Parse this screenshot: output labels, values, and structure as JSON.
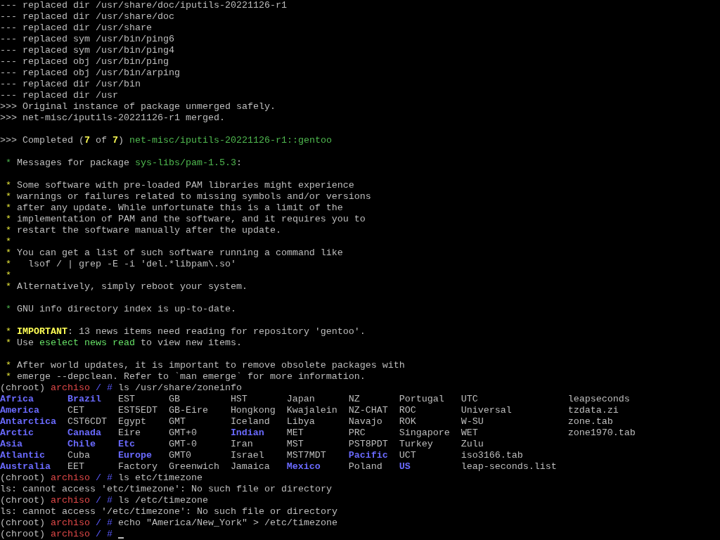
{
  "lines": [
    {
      "kind": "text",
      "segments": [
        {
          "kind": "plain",
          "text": "--- replaced dir /usr/share/doc/iputils-20221126-r1"
        }
      ]
    },
    {
      "kind": "text",
      "segments": [
        {
          "kind": "plain",
          "text": "--- replaced dir /usr/share/doc"
        }
      ]
    },
    {
      "kind": "text",
      "segments": [
        {
          "kind": "plain",
          "text": "--- replaced dir /usr/share"
        }
      ]
    },
    {
      "kind": "text",
      "segments": [
        {
          "kind": "plain",
          "text": "--- replaced sym /usr/bin/ping6"
        }
      ]
    },
    {
      "kind": "text",
      "segments": [
        {
          "kind": "plain",
          "text": "--- replaced sym /usr/bin/ping4"
        }
      ]
    },
    {
      "kind": "text",
      "segments": [
        {
          "kind": "plain",
          "text": "--- replaced obj /usr/bin/ping"
        }
      ]
    },
    {
      "kind": "text",
      "segments": [
        {
          "kind": "plain",
          "text": "--- replaced obj /usr/bin/arping"
        }
      ]
    },
    {
      "kind": "text",
      "segments": [
        {
          "kind": "plain",
          "text": "--- replaced dir /usr/bin"
        }
      ]
    },
    {
      "kind": "text",
      "segments": [
        {
          "kind": "plain",
          "text": "--- replaced dir /usr"
        }
      ]
    },
    {
      "kind": "text",
      "segments": [
        {
          "kind": "plain",
          "text": ">>> Original instance of package unmerged safely."
        }
      ]
    },
    {
      "kind": "text",
      "segments": [
        {
          "kind": "plain",
          "text": ">>> net-misc/iputils-20221126-r1 merged."
        }
      ]
    },
    {
      "kind": "blank"
    },
    {
      "kind": "text",
      "segments": [
        {
          "kind": "plain",
          "text": ">>> Completed ("
        },
        {
          "kind": "number",
          "text": "7"
        },
        {
          "kind": "plain",
          "text": " of "
        },
        {
          "kind": "number",
          "text": "7"
        },
        {
          "kind": "plain",
          "text": ") "
        },
        {
          "kind": "package",
          "text": "net-misc/iputils-20221126-r1::gentoo"
        }
      ]
    },
    {
      "kind": "blank"
    },
    {
      "kind": "text",
      "segments": [
        {
          "kind": "ok-star",
          "text": "*"
        },
        {
          "kind": "plain",
          "text": "Messages for package "
        },
        {
          "kind": "package",
          "text": "sys-libs/pam-1.5.3"
        },
        {
          "kind": "plain",
          "text": ":"
        }
      ]
    },
    {
      "kind": "blank"
    },
    {
      "kind": "text",
      "segments": [
        {
          "kind": "warn-star",
          "text": "*"
        },
        {
          "kind": "plain",
          "text": "Some software with pre-loaded PAM libraries might experience"
        }
      ]
    },
    {
      "kind": "text",
      "segments": [
        {
          "kind": "warn-star",
          "text": "*"
        },
        {
          "kind": "plain",
          "text": "warnings or failures related to missing symbols and/or versions"
        }
      ]
    },
    {
      "kind": "text",
      "segments": [
        {
          "kind": "warn-star",
          "text": "*"
        },
        {
          "kind": "plain",
          "text": "after any update. While unfortunate this is a limit of the"
        }
      ]
    },
    {
      "kind": "text",
      "segments": [
        {
          "kind": "warn-star",
          "text": "*"
        },
        {
          "kind": "plain",
          "text": "implementation of PAM and the software, and it requires you to"
        }
      ]
    },
    {
      "kind": "text",
      "segments": [
        {
          "kind": "warn-star",
          "text": "*"
        },
        {
          "kind": "plain",
          "text": "restart the software manually after the update."
        }
      ]
    },
    {
      "kind": "text",
      "segments": [
        {
          "kind": "warn-star",
          "text": "*"
        }
      ]
    },
    {
      "kind": "text",
      "segments": [
        {
          "kind": "warn-star",
          "text": "*"
        },
        {
          "kind": "plain",
          "text": "You can get a list of such software running a command like"
        }
      ]
    },
    {
      "kind": "text",
      "segments": [
        {
          "kind": "warn-star",
          "text": "*"
        },
        {
          "kind": "plain",
          "text": "  lsof / | grep -E -i 'del.*libpam\\.so'"
        }
      ]
    },
    {
      "kind": "text",
      "segments": [
        {
          "kind": "warn-star",
          "text": "*"
        }
      ]
    },
    {
      "kind": "text",
      "segments": [
        {
          "kind": "warn-star",
          "text": "*"
        },
        {
          "kind": "plain",
          "text": "Alternatively, simply reboot your system."
        }
      ]
    },
    {
      "kind": "blank"
    },
    {
      "kind": "text",
      "segments": [
        {
          "kind": "ok-star",
          "text": "*"
        },
        {
          "kind": "plain",
          "text": "GNU info directory index is up-to-date."
        }
      ]
    },
    {
      "kind": "blank"
    },
    {
      "kind": "text",
      "segments": [
        {
          "kind": "warn-star",
          "text": "*"
        },
        {
          "kind": "important",
          "text": "IMPORTANT"
        },
        {
          "kind": "plain",
          "text": ": 13 news items need reading for repository 'gentoo'."
        }
      ]
    },
    {
      "kind": "text",
      "segments": [
        {
          "kind": "warn-star",
          "text": "*"
        },
        {
          "kind": "plain",
          "text": "Use "
        },
        {
          "kind": "command",
          "text": "eselect news read"
        },
        {
          "kind": "plain",
          "text": " to view new items."
        }
      ]
    },
    {
      "kind": "blank"
    },
    {
      "kind": "text",
      "segments": [
        {
          "kind": "warn-star",
          "text": "*"
        },
        {
          "kind": "plain",
          "text": "After world updates, it is important to remove obsolete packages with"
        }
      ]
    },
    {
      "kind": "text",
      "segments": [
        {
          "kind": "warn-star",
          "text": "*"
        },
        {
          "kind": "plain",
          "text": "emerge --depclean. Refer to `man emerge` for more information."
        }
      ]
    },
    {
      "kind": "prompt",
      "chroot": "(chroot)",
      "host": "archiso",
      "dir": "/",
      "sigil": "#",
      "command": "ls /usr/share/zoneinfo",
      "cursor": false
    },
    {
      "kind": "listing",
      "entries": [
        {
          "name": "Africa",
          "kind": "dir"
        },
        {
          "name": "America",
          "kind": "dir"
        },
        {
          "name": "Antarctica",
          "kind": "dir"
        },
        {
          "name": "Arctic",
          "kind": "dir"
        },
        {
          "name": "Asia",
          "kind": "dir"
        },
        {
          "name": "Atlantic",
          "kind": "dir"
        },
        {
          "name": "Australia",
          "kind": "dir"
        },
        {
          "name": "Brazil",
          "kind": "dir"
        },
        {
          "name": "CET",
          "kind": "file"
        },
        {
          "name": "CST6CDT",
          "kind": "file"
        },
        {
          "name": "Canada",
          "kind": "dir"
        },
        {
          "name": "Chile",
          "kind": "dir"
        },
        {
          "name": "Cuba",
          "kind": "file"
        },
        {
          "name": "EET",
          "kind": "file"
        },
        {
          "name": "EST",
          "kind": "file"
        },
        {
          "name": "EST5EDT",
          "kind": "file"
        },
        {
          "name": "Egypt",
          "kind": "file"
        },
        {
          "name": "Eire",
          "kind": "file"
        },
        {
          "name": "Etc",
          "kind": "dir"
        },
        {
          "name": "Europe",
          "kind": "dir"
        },
        {
          "name": "Factory",
          "kind": "file"
        },
        {
          "name": "GB",
          "kind": "file"
        },
        {
          "name": "GB-Eire",
          "kind": "file"
        },
        {
          "name": "GMT",
          "kind": "file"
        },
        {
          "name": "GMT+0",
          "kind": "file"
        },
        {
          "name": "GMT-0",
          "kind": "file"
        },
        {
          "name": "GMT0",
          "kind": "file"
        },
        {
          "name": "Greenwich",
          "kind": "file"
        },
        {
          "name": "HST",
          "kind": "file"
        },
        {
          "name": "Hongkong",
          "kind": "file"
        },
        {
          "name": "Iceland",
          "kind": "file"
        },
        {
          "name": "Indian",
          "kind": "dir"
        },
        {
          "name": "Iran",
          "kind": "file"
        },
        {
          "name": "Israel",
          "kind": "file"
        },
        {
          "name": "Jamaica",
          "kind": "file"
        },
        {
          "name": "Japan",
          "kind": "file"
        },
        {
          "name": "Kwajalein",
          "kind": "file"
        },
        {
          "name": "Libya",
          "kind": "file"
        },
        {
          "name": "MET",
          "kind": "file"
        },
        {
          "name": "MST",
          "kind": "file"
        },
        {
          "name": "MST7MDT",
          "kind": "file"
        },
        {
          "name": "Mexico",
          "kind": "dir"
        },
        {
          "name": "NZ",
          "kind": "file"
        },
        {
          "name": "NZ-CHAT",
          "kind": "file"
        },
        {
          "name": "Navajo",
          "kind": "file"
        },
        {
          "name": "PRC",
          "kind": "file"
        },
        {
          "name": "PST8PDT",
          "kind": "file"
        },
        {
          "name": "Pacific",
          "kind": "dir"
        },
        {
          "name": "Poland",
          "kind": "file"
        },
        {
          "name": "Portugal",
          "kind": "file"
        },
        {
          "name": "ROC",
          "kind": "file"
        },
        {
          "name": "ROK",
          "kind": "file"
        },
        {
          "name": "Singapore",
          "kind": "file"
        },
        {
          "name": "Turkey",
          "kind": "file"
        },
        {
          "name": "UCT",
          "kind": "file"
        },
        {
          "name": "US",
          "kind": "dir"
        },
        {
          "name": "UTC",
          "kind": "file"
        },
        {
          "name": "Universal",
          "kind": "file"
        },
        {
          "name": "W-SU",
          "kind": "file"
        },
        {
          "name": "WET",
          "kind": "file"
        },
        {
          "name": "Zulu",
          "kind": "file"
        },
        {
          "name": "iso3166.tab",
          "kind": "file"
        },
        {
          "name": "leap-seconds.list",
          "kind": "file"
        },
        {
          "name": "leapseconds",
          "kind": "file"
        },
        {
          "name": "tzdata.zi",
          "kind": "file"
        },
        {
          "name": "zone.tab",
          "kind": "file"
        },
        {
          "name": "zone1970.tab",
          "kind": "file"
        }
      ]
    },
    {
      "kind": "prompt",
      "chroot": "(chroot)",
      "host": "archiso",
      "dir": "/",
      "sigil": "#",
      "command": "ls etc/timezone",
      "cursor": false
    },
    {
      "kind": "text",
      "segments": [
        {
          "kind": "plain",
          "text": "ls: cannot access 'etc/timezone': No such file or directory"
        }
      ]
    },
    {
      "kind": "prompt",
      "chroot": "(chroot)",
      "host": "archiso",
      "dir": "/",
      "sigil": "#",
      "command": "ls /etc/timezone",
      "cursor": false
    },
    {
      "kind": "text",
      "segments": [
        {
          "kind": "plain",
          "text": "ls: cannot access '/etc/timezone': No such file or directory"
        }
      ]
    },
    {
      "kind": "prompt",
      "chroot": "(chroot)",
      "host": "archiso",
      "dir": "/",
      "sigil": "#",
      "command": "echo \"America/New_York\" > /etc/timezone",
      "cursor": false
    },
    {
      "kind": "prompt",
      "chroot": "(chroot)",
      "host": "archiso",
      "dir": "/",
      "sigil": "#",
      "cursor": true
    }
  ]
}
